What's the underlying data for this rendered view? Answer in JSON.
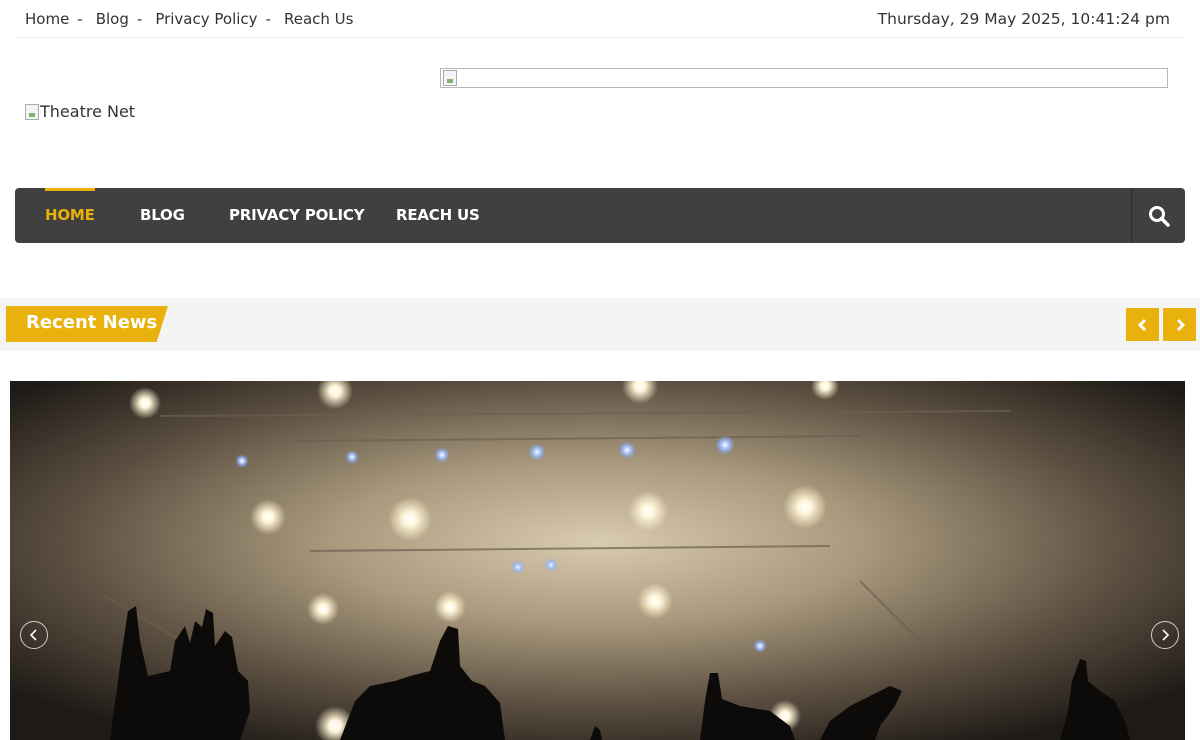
{
  "topbar": {
    "links": [
      {
        "label": "Home"
      },
      {
        "label": "Blog"
      },
      {
        "label": "Privacy Policy"
      },
      {
        "label": "Reach Us"
      }
    ],
    "separator": "-",
    "datetime": "Thursday, 29 May 2025, 10:41:24 pm"
  },
  "header": {
    "logo_alt": "Theatre Net"
  },
  "nav": {
    "items": [
      {
        "label": "HOME",
        "active": true
      },
      {
        "label": "BLOG"
      },
      {
        "label": "PRIVACY POLICY"
      },
      {
        "label": "REACH US"
      }
    ],
    "search_icon": "search-icon"
  },
  "recent_news": {
    "label": "Recent News",
    "prev_icon": "chevron-left-icon",
    "next_icon": "chevron-right-icon"
  },
  "slider": {
    "image_subject": "concert-stage-lights-crowd",
    "prev_icon": "circle-chevron-left-icon",
    "next_icon": "circle-chevron-right-icon"
  },
  "colors": {
    "accent": "#e9b10b",
    "nav_bg": "#404040",
    "band_bg": "#f4f4f4"
  }
}
